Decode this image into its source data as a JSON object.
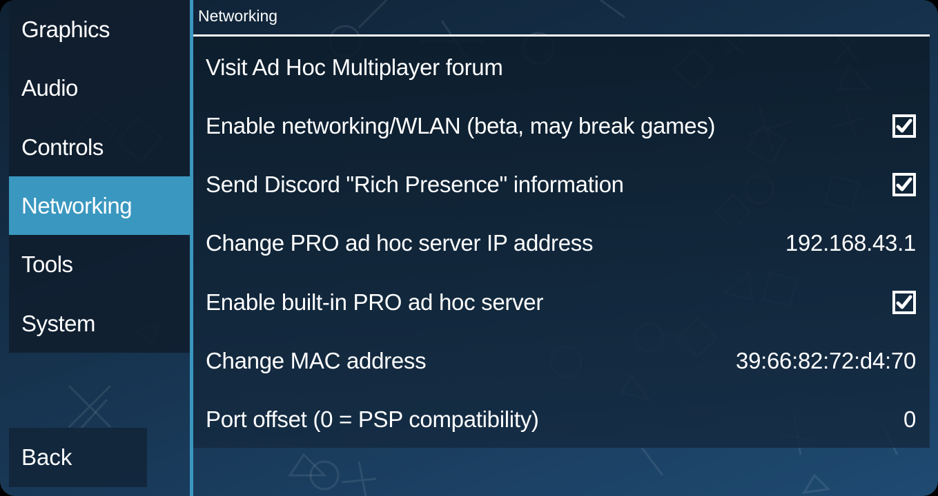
{
  "sidebar": {
    "items": [
      {
        "label": "Graphics",
        "active": false
      },
      {
        "label": "Audio",
        "active": false
      },
      {
        "label": "Controls",
        "active": false
      },
      {
        "label": "Networking",
        "active": true
      },
      {
        "label": "Tools",
        "active": false
      },
      {
        "label": "System",
        "active": false
      }
    ],
    "back_label": "Back"
  },
  "content": {
    "title": "Networking",
    "settings": [
      {
        "label": "Visit Ad Hoc Multiplayer forum",
        "type": "link"
      },
      {
        "label": "Enable networking/WLAN (beta, may break games)",
        "type": "checkbox",
        "checked": true
      },
      {
        "label": "Send Discord \"Rich Presence\" information",
        "type": "checkbox",
        "checked": true
      },
      {
        "label": "Change PRO ad hoc server IP address",
        "type": "value",
        "value": "192.168.43.1"
      },
      {
        "label": "Enable built-in PRO ad hoc server",
        "type": "checkbox",
        "checked": true
      },
      {
        "label": "Change MAC address",
        "type": "value",
        "value": "39:66:82:72:d4:70"
      },
      {
        "label": "Port offset (0 = PSP compatibility)",
        "type": "value",
        "value": "0"
      }
    ]
  },
  "colors": {
    "accent": "#3a97c0",
    "text": "#ffffff",
    "panel": "#10202e"
  }
}
